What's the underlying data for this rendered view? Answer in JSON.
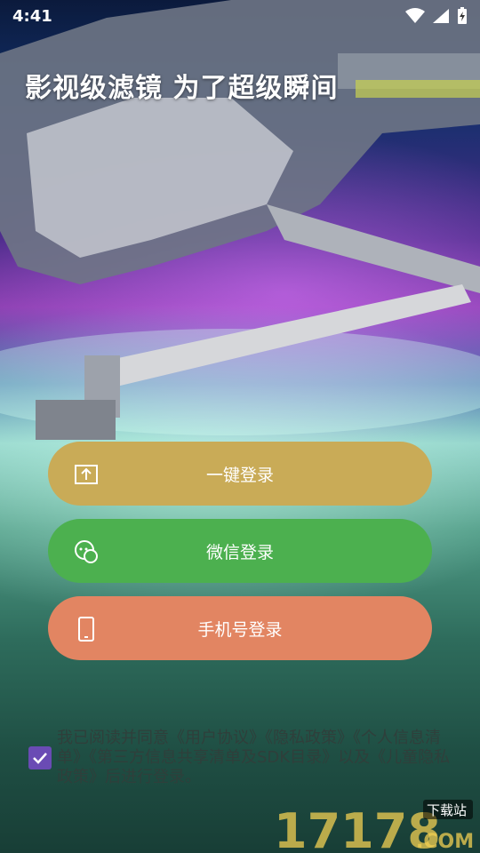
{
  "status_bar": {
    "time": "4:41"
  },
  "headline": "影视级滤镜 为了超级瞬间",
  "buttons": {
    "one_key": {
      "label": "一键登录",
      "icon": "upload-box-icon"
    },
    "wechat": {
      "label": "微信登录",
      "icon": "wechat-icon"
    },
    "phone": {
      "label": "手机号登录",
      "icon": "phone-icon"
    }
  },
  "agreement": {
    "checked": true,
    "text": "我已阅读并同意《用户协议》《隐私政策》《个人信息清单》《第三方信息共享清单及SDK目录》以及《儿童隐私政策》后进行登录。"
  },
  "watermark": {
    "logo": "17178.COM",
    "tag": "下载站"
  },
  "colors": {
    "one_key": "#c9ab57",
    "wechat": "#4cb04f",
    "phone": "#e28562",
    "checkbox": "#6a4bb4"
  }
}
